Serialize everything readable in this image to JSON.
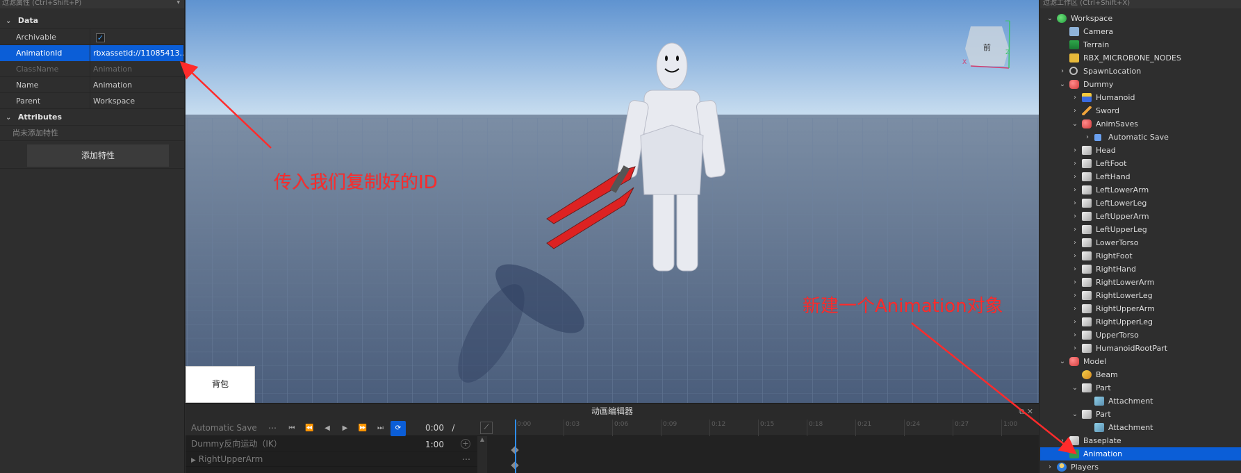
{
  "properties": {
    "title": "过滤属性 (Ctrl+Shift+P)",
    "sections": {
      "data_label": "Data",
      "attributes_label": "Attributes"
    },
    "rows": [
      {
        "key": "Archivable",
        "value": "✓",
        "type": "checkbox"
      },
      {
        "key": "AnimationId",
        "value": "rbxassetid://11085413...",
        "selected": true
      },
      {
        "key": "ClassName",
        "value": "Animation",
        "disabled": true
      },
      {
        "key": "Name",
        "value": "Animation"
      },
      {
        "key": "Parent",
        "value": "Workspace"
      }
    ],
    "no_attributes": "尚未添加特性",
    "add_attribute_button": "添加特性"
  },
  "viewport": {
    "gizmo_label": "前",
    "annotation_1": "传入我们复制好的ID",
    "annotation_2": "新建一个Animation对象",
    "backpack_label": "背包",
    "annotation_color": "#ff2b2b"
  },
  "anim_editor": {
    "title": "动画编辑器",
    "animation_name": "Automatic Save",
    "time_current": "0:00",
    "time_separator": "/",
    "time_total": "1:00",
    "ruler_ticks": [
      "0:00",
      "0:03",
      "0:06",
      "0:09",
      "0:12",
      "0:15",
      "0:18",
      "0:21",
      "0:24",
      "0:27",
      "1:00"
    ],
    "track_rows": [
      "Dummy反向运动（IK）",
      "RightUpperArm"
    ]
  },
  "explorer": {
    "title": "过滤工作区 (Ctrl+Shift+X)",
    "tree": [
      {
        "label": "Workspace",
        "depth": 0,
        "arrow": "open",
        "icon": "workspace"
      },
      {
        "label": "Camera",
        "depth": 1,
        "arrow": "none",
        "icon": "camera"
      },
      {
        "label": "Terrain",
        "depth": 1,
        "arrow": "none",
        "icon": "terrain"
      },
      {
        "label": "RBX_MICROBONE_NODES",
        "depth": 1,
        "arrow": "none",
        "icon": "folder"
      },
      {
        "label": "SpawnLocation",
        "depth": 1,
        "arrow": "closed",
        "icon": "spawn"
      },
      {
        "label": "Dummy",
        "depth": 1,
        "arrow": "open",
        "icon": "model"
      },
      {
        "label": "Humanoid",
        "depth": 2,
        "arrow": "closed",
        "icon": "humanoid"
      },
      {
        "label": "Sword",
        "depth": 2,
        "arrow": "closed",
        "icon": "tool"
      },
      {
        "label": "AnimSaves",
        "depth": 2,
        "arrow": "open",
        "icon": "model"
      },
      {
        "label": "Automatic Save",
        "depth": 3,
        "arrow": "closed",
        "icon": "save"
      },
      {
        "label": "Head",
        "depth": 2,
        "arrow": "closed",
        "icon": "part"
      },
      {
        "label": "LeftFoot",
        "depth": 2,
        "arrow": "closed",
        "icon": "part"
      },
      {
        "label": "LeftHand",
        "depth": 2,
        "arrow": "closed",
        "icon": "part"
      },
      {
        "label": "LeftLowerArm",
        "depth": 2,
        "arrow": "closed",
        "icon": "part"
      },
      {
        "label": "LeftLowerLeg",
        "depth": 2,
        "arrow": "closed",
        "icon": "part"
      },
      {
        "label": "LeftUpperArm",
        "depth": 2,
        "arrow": "closed",
        "icon": "part"
      },
      {
        "label": "LeftUpperLeg",
        "depth": 2,
        "arrow": "closed",
        "icon": "part"
      },
      {
        "label": "LowerTorso",
        "depth": 2,
        "arrow": "closed",
        "icon": "part"
      },
      {
        "label": "RightFoot",
        "depth": 2,
        "arrow": "closed",
        "icon": "part"
      },
      {
        "label": "RightHand",
        "depth": 2,
        "arrow": "closed",
        "icon": "part"
      },
      {
        "label": "RightLowerArm",
        "depth": 2,
        "arrow": "closed",
        "icon": "part"
      },
      {
        "label": "RightLowerLeg",
        "depth": 2,
        "arrow": "closed",
        "icon": "part"
      },
      {
        "label": "RightUpperArm",
        "depth": 2,
        "arrow": "closed",
        "icon": "part"
      },
      {
        "label": "RightUpperLeg",
        "depth": 2,
        "arrow": "closed",
        "icon": "part"
      },
      {
        "label": "UpperTorso",
        "depth": 2,
        "arrow": "closed",
        "icon": "part"
      },
      {
        "label": "HumanoidRootPart",
        "depth": 2,
        "arrow": "closed",
        "icon": "part"
      },
      {
        "label": "Model",
        "depth": 1,
        "arrow": "open",
        "icon": "model"
      },
      {
        "label": "Beam",
        "depth": 2,
        "arrow": "none",
        "icon": "beam"
      },
      {
        "label": "Part",
        "depth": 2,
        "arrow": "open",
        "icon": "part"
      },
      {
        "label": "Attachment",
        "depth": 3,
        "arrow": "none",
        "icon": "attach"
      },
      {
        "label": "Part",
        "depth": 2,
        "arrow": "open",
        "icon": "part"
      },
      {
        "label": "Attachment",
        "depth": 3,
        "arrow": "none",
        "icon": "attach"
      },
      {
        "label": "Baseplate",
        "depth": 1,
        "arrow": "closed",
        "icon": "part"
      },
      {
        "label": "Animation",
        "depth": 1,
        "arrow": "none",
        "icon": "anim",
        "selected": true
      },
      {
        "label": "Players",
        "depth": 0,
        "arrow": "closed",
        "icon": "players"
      }
    ]
  }
}
